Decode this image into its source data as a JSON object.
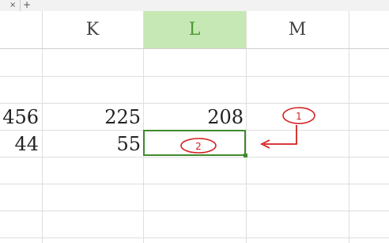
{
  "tabbar": {
    "close_glyph": "×",
    "add_glyph": "+"
  },
  "spreadsheet": {
    "columns": [
      {
        "label": "",
        "selected": false
      },
      {
        "label": "K",
        "selected": false
      },
      {
        "label": "L",
        "selected": true
      },
      {
        "label": "M",
        "selected": false
      }
    ],
    "rows": [
      {
        "J": "456",
        "K": "225",
        "L": "208",
        "M": ""
      },
      {
        "J": "44",
        "K": "55",
        "L": "",
        "M": ""
      }
    ],
    "selected_cell": "L"
  },
  "annotations": {
    "marker_1": "1",
    "marker_2": "2",
    "color": "#d42020"
  },
  "colors": {
    "selected_header_bg": "#c6e8b4",
    "selected_header_text": "#4e9a2f",
    "selection_border": "#3f8a2d",
    "gridline": "#dedede"
  }
}
